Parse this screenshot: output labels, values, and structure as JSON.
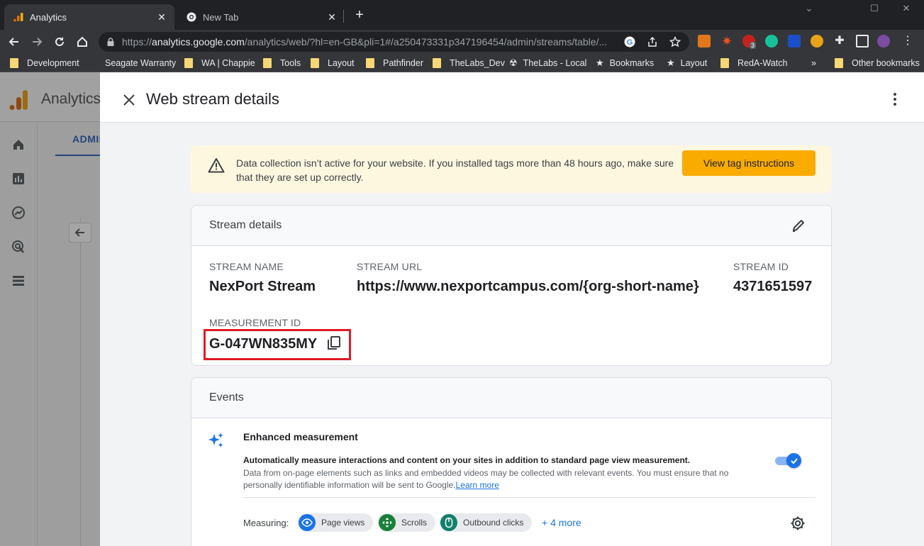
{
  "browser": {
    "tabs": [
      {
        "title": "Analytics",
        "active": true
      },
      {
        "title": "New Tab",
        "active": false
      }
    ],
    "url_prefix": "https://",
    "url_host": "analytics.google.com",
    "url_path": "/analytics/web/?hl=en-GB&pli=1#/a250473331p347196454/admin/streams/table/...",
    "ext_badge": "3",
    "bookmarks": [
      {
        "label": "Development",
        "icon": "folder-icon"
      },
      {
        "label": "Seagate Warranty",
        "icon": "none"
      },
      {
        "label": "WA | Chappie",
        "icon": "folder-icon"
      },
      {
        "label": "Tools",
        "icon": "folder-icon"
      },
      {
        "label": "Layout",
        "icon": "folder-icon"
      },
      {
        "label": "Pathfinder",
        "icon": "folder-icon"
      },
      {
        "label": "TheLabs_Dev",
        "icon": "folder-icon"
      },
      {
        "label": "TheLabs - Local",
        "icon": "site-icon"
      },
      {
        "label": "Bookmarks",
        "icon": "star-icon"
      },
      {
        "label": "Layout",
        "icon": "star-icon"
      },
      {
        "label": "RedA-Watch",
        "icon": "folder-icon"
      }
    ],
    "bookmarks_overflow": "»",
    "other_bookmarks": "Other bookmarks"
  },
  "background": {
    "app_title": "Analytics",
    "admin_tab": "ADMIN"
  },
  "drawer": {
    "title": "Web stream details",
    "banner": {
      "message": "Data collection isn’t active for your website. If you installed tags more than 48 hours ago, make sure that they are set up correctly.",
      "button": "View tag instructions"
    },
    "stream_details": {
      "heading": "Stream details",
      "stream_name_label": "STREAM NAME",
      "stream_name": "NexPort Stream",
      "stream_url_label": "STREAM URL",
      "stream_url": "https://www.nexportcampus.com/{org-short-name}",
      "stream_id_label": "STREAM ID",
      "stream_id": "4371651597",
      "measurement_id_label": "MEASUREMENT ID",
      "measurement_id": "G-047WN835MY"
    },
    "events": {
      "heading": "Events",
      "enhanced_title": "Enhanced measurement",
      "enhanced_desc_bold": "Automatically measure interactions and content on your sites in addition to standard page view measurement.",
      "enhanced_desc": "Data from on-page elements such as links and embedded videos may be collected with relevant events. You must ensure that no personally identifiable information will be sent to Google.",
      "learn_more": "Learn more",
      "enabled": true,
      "measuring_label": "Measuring:",
      "chips": [
        {
          "label": "Page views",
          "icon": "eye-icon",
          "color": "#1a73e8"
        },
        {
          "label": "Scrolls",
          "icon": "scroll-arrows-icon",
          "color": "#188038"
        },
        {
          "label": "Outbound clicks",
          "icon": "mouse-icon",
          "color": "#12806b"
        }
      ],
      "more_link": "+ 4 more"
    }
  },
  "colors": {
    "accent": "#1a73e8",
    "banner_bg": "#fef7e0",
    "banner_button": "#f9ab00",
    "highlight": "#e01b24"
  }
}
